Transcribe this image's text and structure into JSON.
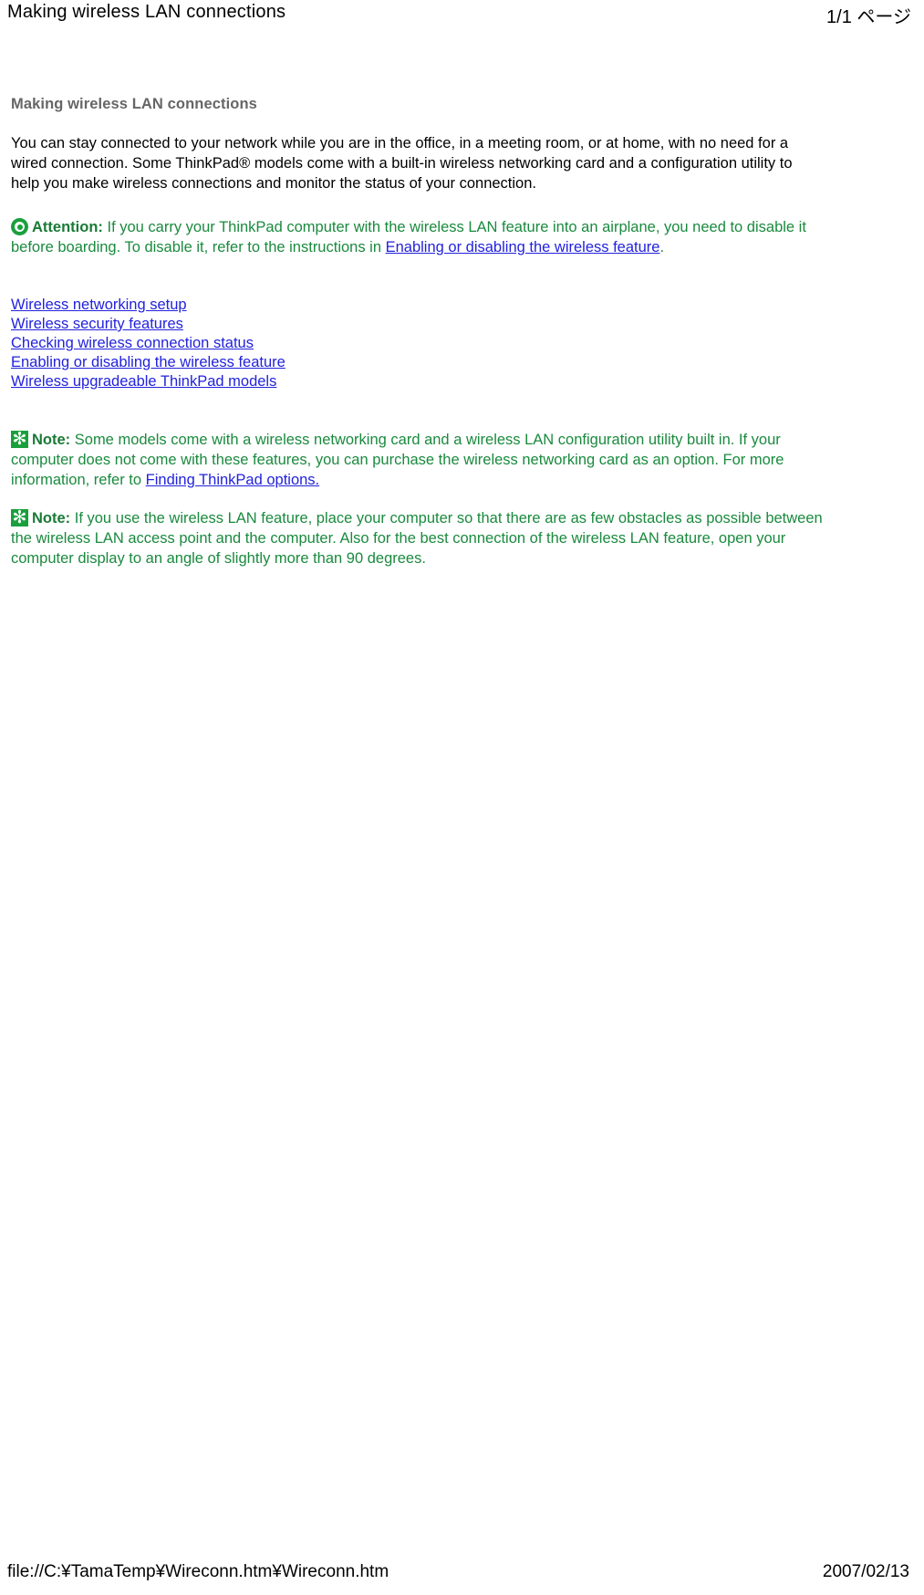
{
  "print_header": {
    "title": "Making wireless LAN connections",
    "page_indicator": "1/1 ページ"
  },
  "document": {
    "title": "Making wireless LAN connections",
    "intro_paragraph": "You can stay connected to your network while you are in the office, in a meeting room, or at home, with no need for a wired connection. Some ThinkPad® models come with a built-in wireless networking card and a configuration utility to help you make wireless connections and monitor the status of your connection.",
    "attention": {
      "icon": "attention-eye-icon",
      "lead": "Attention:",
      "text_before_link": " If you carry your ThinkPad computer with the wireless LAN feature into an airplane, you need to disable it before boarding. To disable it, refer to the instructions in ",
      "link": "Enabling or disabling the wireless feature",
      "text_after_link": "."
    },
    "link_list": [
      "Wireless networking setup",
      "Wireless security features",
      "Checking wireless connection status",
      "Enabling or disabling the wireless feature",
      "Wireless upgradeable ThinkPad models"
    ],
    "note_1": {
      "icon": "note-asterisk-icon",
      "glyph": "✻",
      "lead": "Note:",
      "text_before_link": " Some models come with a wireless networking card and a wireless LAN configuration utility built in. If your computer does not come with these features, you can purchase the wireless networking card as an option. For more information, refer to ",
      "link": "Finding ThinkPad options.",
      "text_after_link": ""
    },
    "note_2": {
      "icon": "note-asterisk-icon",
      "glyph": "✻",
      "lead": "Note:",
      "text": " If you use the wireless LAN feature, place your computer so that there are as few obstacles as possible between the wireless LAN access point and the computer. Also for the best connection of the wireless LAN feature, open your computer display to an angle of slightly more than 90 degrees."
    }
  },
  "print_footer": {
    "path": "file://C:¥TamaTemp¥Wireconn.htm¥Wireconn.htm",
    "date": "2007/02/13"
  },
  "colors": {
    "link": "#2222dd",
    "notice_green": "#1a8a3e",
    "title_gray": "#666666",
    "icon_green": "#19a03c"
  }
}
